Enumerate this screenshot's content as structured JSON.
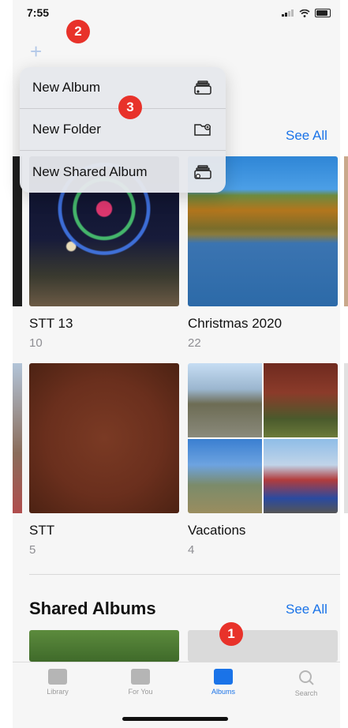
{
  "status_bar": {
    "time": "7:55"
  },
  "toolbar": {
    "add_symbol": "+"
  },
  "menu": {
    "items": [
      {
        "label": "New Album",
        "icon": "album-icon"
      },
      {
        "label": "New Folder",
        "icon": "folder-plus-icon"
      },
      {
        "label": "New Shared Album",
        "icon": "shared-album-icon"
      }
    ]
  },
  "my_albums": {
    "see_all": "See All",
    "albums": [
      {
        "title": "STT 13",
        "count": "10"
      },
      {
        "title": "Christmas 2020",
        "count": "22"
      },
      {
        "title": "STT",
        "count": "5"
      },
      {
        "title": "Vacations",
        "count": "4"
      }
    ]
  },
  "shared_albums": {
    "title": "Shared Albums",
    "see_all": "See All"
  },
  "tabbar": {
    "tabs": [
      {
        "label": "Library",
        "icon": "library-icon"
      },
      {
        "label": "For You",
        "icon": "for-you-icon"
      },
      {
        "label": "Albums",
        "icon": "albums-icon",
        "active": true
      },
      {
        "label": "Search",
        "icon": "search-icon"
      }
    ]
  },
  "annotations": {
    "badge_1": "1",
    "badge_2": "2",
    "badge_3": "3"
  },
  "colors": {
    "accent": "#1a73e8",
    "badge": "#e8322a"
  }
}
